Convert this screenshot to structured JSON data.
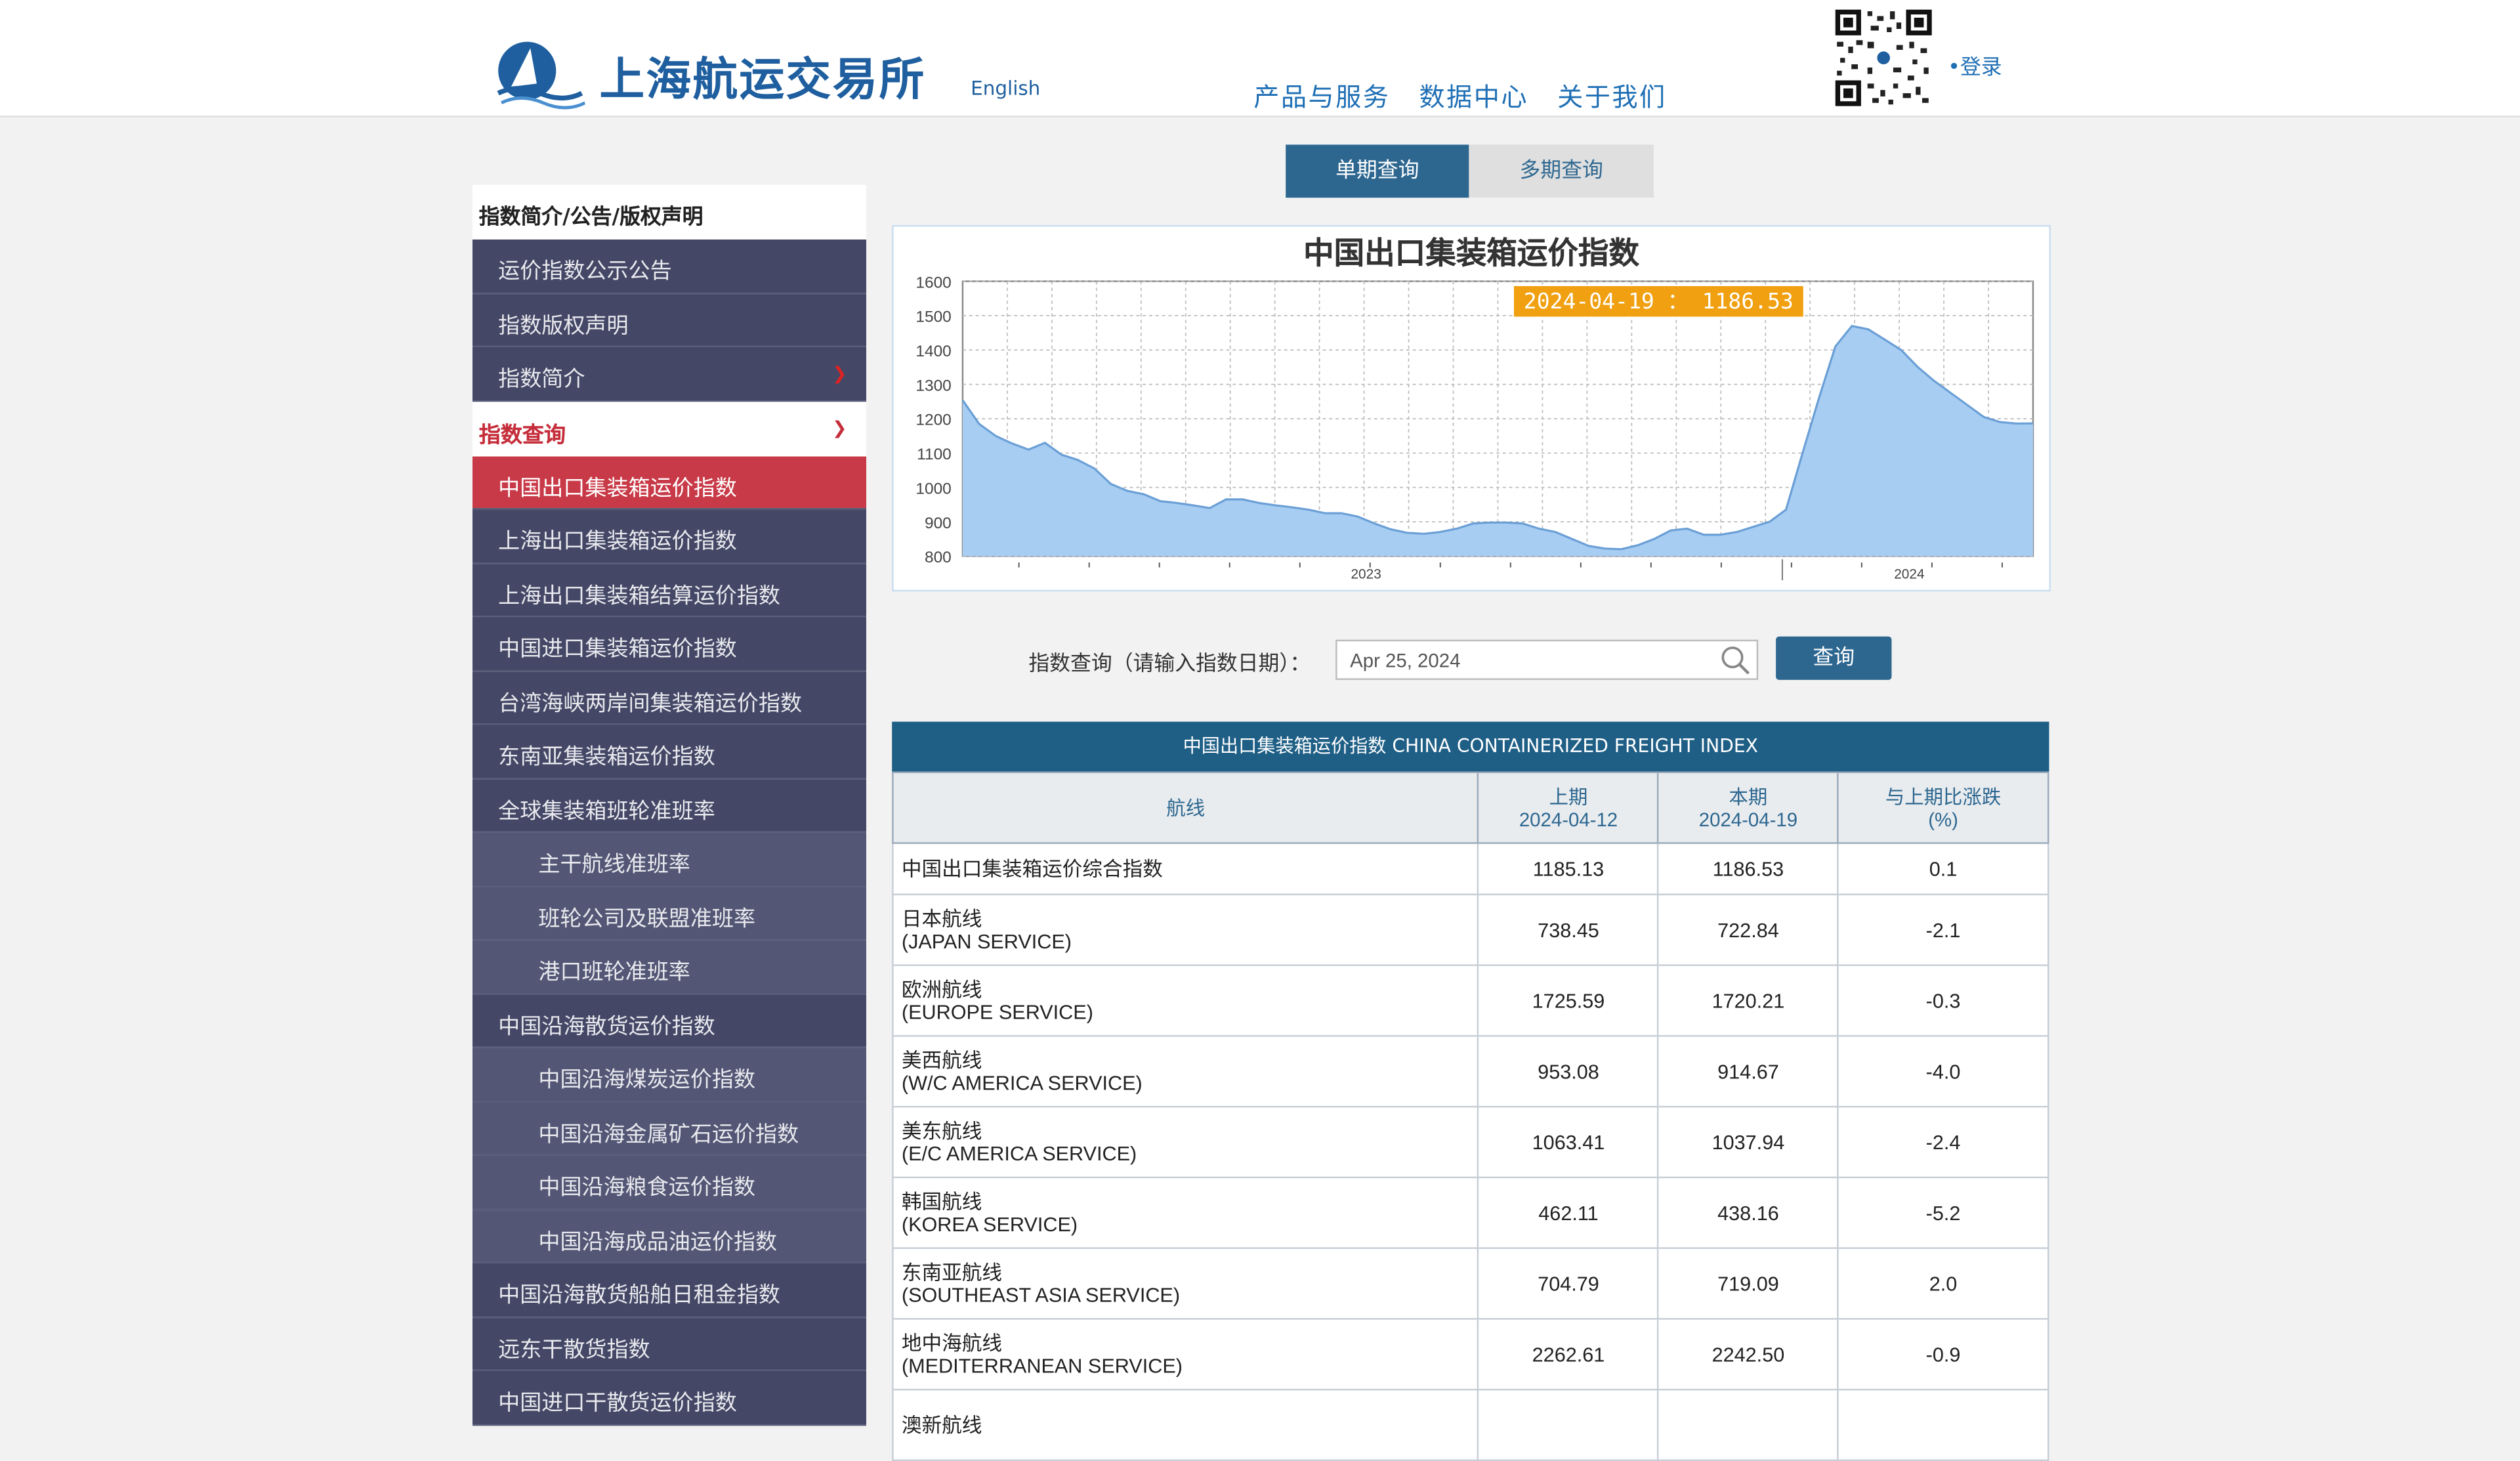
{
  "header": {
    "logo_text": "上海航运交易所",
    "english": "English",
    "nav": [
      "产品与服务",
      "数据中心",
      "关于我们"
    ],
    "login": "•登录"
  },
  "sidebar": {
    "head": "指数简介/公告/版权声明",
    "items_top": [
      "运价指数公示公告",
      "指数版权声明",
      "指数简介"
    ],
    "section_query": "指数查询",
    "selected": "中国出口集装箱运价指数",
    "items": [
      {
        "label": "上海出口集装箱运价指数",
        "sub": false
      },
      {
        "label": "上海出口集装箱结算运价指数",
        "sub": false
      },
      {
        "label": "中国进口集装箱运价指数",
        "sub": false
      },
      {
        "label": "台湾海峡两岸间集装箱运价指数",
        "sub": false
      },
      {
        "label": "东南亚集装箱运价指数",
        "sub": false
      },
      {
        "label": "全球集装箱班轮准班率",
        "sub": false
      },
      {
        "label": "主干航线准班率",
        "sub": true
      },
      {
        "label": "班轮公司及联盟准班率",
        "sub": true
      },
      {
        "label": "港口班轮准班率",
        "sub": true
      },
      {
        "label": "中国沿海散货运价指数",
        "sub": false
      },
      {
        "label": "中国沿海煤炭运价指数",
        "sub": true
      },
      {
        "label": "中国沿海金属矿石运价指数",
        "sub": true
      },
      {
        "label": "中国沿海粮食运价指数",
        "sub": true
      },
      {
        "label": "中国沿海成品油运价指数",
        "sub": true
      },
      {
        "label": "中国沿海散货船舶日租金指数",
        "sub": false
      },
      {
        "label": "远东干散货指数",
        "sub": false
      },
      {
        "label": "中国进口干散货运价指数",
        "sub": false
      }
    ]
  },
  "tabs": {
    "single": "单期查询",
    "multi": "多期查询"
  },
  "chart_data": {
    "type": "area",
    "title": "中国出口集装箱运价指数",
    "tooltip": "2024-04-19 ： 1186.53",
    "yticks": [
      "1600",
      "1500",
      "1400",
      "1300",
      "1200",
      "1100",
      "1000",
      "900",
      "800"
    ],
    "ylim": [
      800,
      1600
    ],
    "xticklabels": [
      "2023",
      "2024"
    ],
    "values": [
      1254,
      1185,
      1150,
      1128,
      1110,
      1130,
      1095,
      1080,
      1055,
      1010,
      990,
      980,
      960,
      955,
      948,
      940,
      965,
      965,
      955,
      948,
      942,
      935,
      925,
      925,
      915,
      895,
      878,
      868,
      865,
      870,
      880,
      895,
      898,
      898,
      895,
      880,
      870,
      850,
      830,
      822,
      820,
      832,
      850,
      875,
      880,
      862,
      862,
      870,
      885,
      900,
      935,
      1100,
      1260,
      1410,
      1470,
      1460,
      1430,
      1400,
      1350,
      1310,
      1275,
      1240,
      1205,
      1190,
      1186,
      1186.53
    ],
    "color_fill": "#a8cdf2",
    "color_line": "#6a9fd6",
    "color_tooltip": "#f0a010"
  },
  "query": {
    "label": "指数查询（请输入指数日期）：",
    "date": "Apr 25, 2024",
    "button": "查询"
  },
  "table": {
    "title": "中国出口集装箱运价指数 CHINA CONTAINERIZED FREIGHT INDEX",
    "headers": {
      "route": "航线",
      "prev": "上期",
      "prev_date": "2024-04-12",
      "curr": "本期",
      "curr_date": "2024-04-19",
      "change": "与上期比涨跌",
      "change_unit": "(%)"
    },
    "rows": [
      {
        "cn": "中国出口集装箱运价综合指数",
        "en": "",
        "prev": "1185.13",
        "curr": "1186.53",
        "chg": "0.1"
      },
      {
        "cn": "日本航线",
        "en": "(JAPAN SERVICE)",
        "prev": "738.45",
        "curr": "722.84",
        "chg": "-2.1"
      },
      {
        "cn": "欧洲航线",
        "en": "(EUROPE SERVICE)",
        "prev": "1725.59",
        "curr": "1720.21",
        "chg": "-0.3"
      },
      {
        "cn": "美西航线",
        "en": "(W/C AMERICA SERVICE)",
        "prev": "953.08",
        "curr": "914.67",
        "chg": "-4.0"
      },
      {
        "cn": "美东航线",
        "en": "(E/C AMERICA SERVICE)",
        "prev": "1063.41",
        "curr": "1037.94",
        "chg": "-2.4"
      },
      {
        "cn": "韩国航线",
        "en": "(KOREA SERVICE)",
        "prev": "462.11",
        "curr": "438.16",
        "chg": "-5.2"
      },
      {
        "cn": "东南亚航线",
        "en": "(SOUTHEAST ASIA SERVICE)",
        "prev": "704.79",
        "curr": "719.09",
        "chg": "2.0"
      },
      {
        "cn": "地中海航线",
        "en": "(MEDITERRANEAN SERVICE)",
        "prev": "2262.61",
        "curr": "2242.50",
        "chg": "-0.9"
      },
      {
        "cn": "澳新航线",
        "en": "",
        "prev": "",
        "curr": "",
        "chg": ""
      }
    ]
  }
}
